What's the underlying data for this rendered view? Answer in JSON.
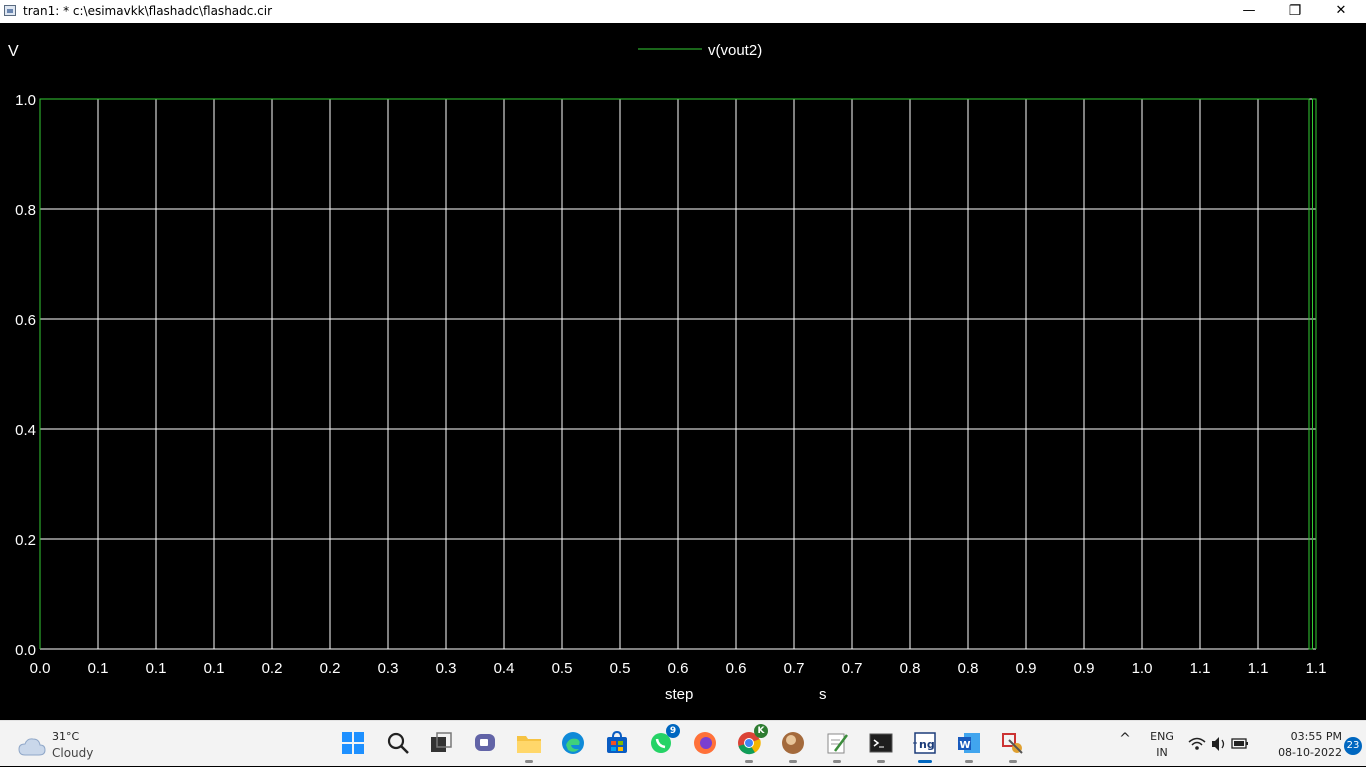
{
  "window": {
    "title": "tran1: * c:\\esimavkk\\flashadc\\flashadc.cir",
    "minimize": "—",
    "maximize": "❐",
    "close": "✕"
  },
  "plot": {
    "y_unit": "V",
    "legend": "v(vout2)",
    "x_label": "step",
    "x_unit": "s",
    "background": "#000000",
    "grid_color": "#ffffff",
    "trace_color": "#33cc33"
  },
  "chart_data": {
    "type": "line",
    "series": [
      {
        "name": "v(vout2)",
        "x": [
          0.0,
          0.0,
          1.094,
          1.094,
          1.097,
          1.097,
          1.1,
          1.1,
          1.1
        ],
        "y": [
          0.0,
          1.0,
          1.0,
          0.0,
          0.0,
          1.0,
          1.0,
          0.0,
          0.0
        ]
      }
    ],
    "x_tick_labels": [
      "0.0",
      "0.1",
      "0.1",
      "0.1",
      "0.2",
      "0.2",
      "0.3",
      "0.3",
      "0.4",
      "0.5",
      "0.5",
      "0.6",
      "0.6",
      "0.7",
      "0.7",
      "0.8",
      "0.8",
      "0.9",
      "0.9",
      "1.0",
      "1.1",
      "1.1",
      "1.1"
    ],
    "y_tick_labels": [
      "1.0",
      "0.8",
      "0.6",
      "0.4",
      "0.2",
      "0.0"
    ],
    "xlim": [
      0.0,
      1.1
    ],
    "ylim": [
      0.0,
      1.0
    ],
    "grid": true,
    "legend_position": "top-center",
    "ylabel": "V",
    "xlabel": "step",
    "x_unit": "s"
  },
  "taskbar": {
    "weather": {
      "temp": "31°C",
      "condition": "Cloudy"
    },
    "apps": [
      {
        "name": "start-button",
        "icon": "windows-icon"
      },
      {
        "name": "search-button",
        "icon": "search-icon"
      },
      {
        "name": "task-view-button",
        "icon": "task-view-icon"
      },
      {
        "name": "teams-chat-button",
        "icon": "chat-icon"
      },
      {
        "name": "file-explorer-button",
        "icon": "folder-icon"
      },
      {
        "name": "edge-button",
        "icon": "edge-icon"
      },
      {
        "name": "store-button",
        "icon": "store-icon"
      },
      {
        "name": "whatsapp-button",
        "icon": "whatsapp-icon",
        "badge": "9"
      },
      {
        "name": "firefox-button",
        "icon": "firefox-icon"
      },
      {
        "name": "chrome-button",
        "icon": "chrome-icon",
        "badge": "K"
      },
      {
        "name": "app-sphere-button",
        "icon": "sphere-icon"
      },
      {
        "name": "notepad-button",
        "icon": "notepad-icon"
      },
      {
        "name": "terminal-button",
        "icon": "terminal-icon"
      },
      {
        "name": "ngspice-button",
        "icon": "ngspice-icon"
      },
      {
        "name": "word-button",
        "icon": "word-icon"
      },
      {
        "name": "tool-button",
        "icon": "tool-icon"
      }
    ],
    "tray": {
      "chevron": "^",
      "lang_top": "ENG",
      "lang_bottom": "IN",
      "time": "03:55 PM",
      "date": "08-10-2022",
      "notifications": "23"
    }
  }
}
